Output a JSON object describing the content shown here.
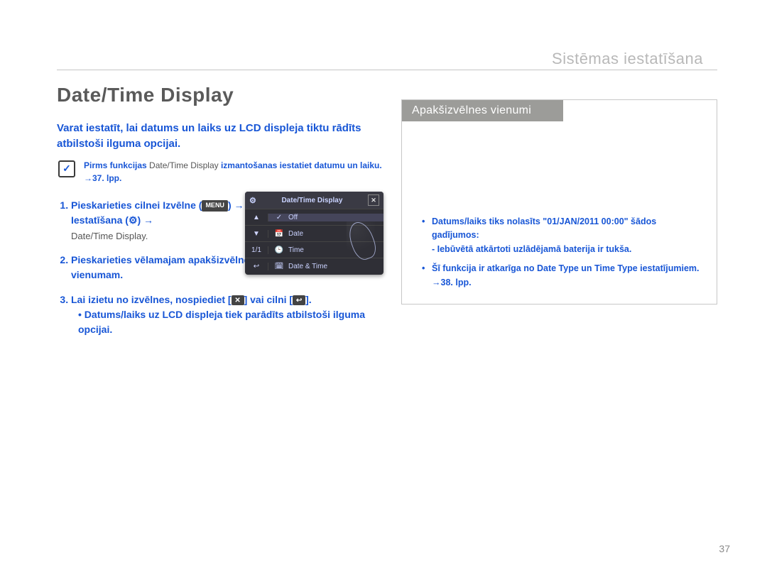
{
  "breadcrumb": "Sistēmas iestatīšana",
  "title": "Date/Time Display",
  "intro": "Varat iestatīt, lai datums un laiks uz LCD displeja tiktu rādīts atbilstoši ilguma opcijai.",
  "note": {
    "line1_pre": "Pirms funkcijas ",
    "line1_em": "Date/Time Display",
    "line1_post": " izmantošanas iestatiet datumu un laiku. →37. lpp."
  },
  "steps": {
    "s1_main": "Pieskarieties cilnei Izvēlne (",
    "s1_btn": "MENU",
    "s1_main2": ") → Iestatīšana (",
    "s1_icon": "⚙",
    "s1_main3": ") →",
    "s1_sub": "Date/Time Display.",
    "s2_main": "Pieskarieties vēlamajam apakšizvēlnes vienumam.",
    "s3_main": "Lai izietu no izvēlnes, nospiediet [",
    "s3_icon1": "✕",
    "s3_main2": "] vai cilni [",
    "s3_icon2": "↩",
    "s3_main3": "].",
    "s3_bullet": "Datums/laiks uz LCD displeja tiek parādīts atbilstoši ilguma opcijai."
  },
  "screen": {
    "title": "Date/Time Display",
    "row_off": "Off",
    "row_date": "Date",
    "row_time": "Time",
    "row_both": "Date & Time",
    "pager": "1/1"
  },
  "rightbox": {
    "header": "Apakšizvēlnes vienumi",
    "b1": "Datums/laiks tiks nolasīts \"01/JAN/2011 00:00\" šādos gadījumos:",
    "b1a": "- Iebūvētā atkārtoti uzlādējamā baterija ir tukša.",
    "b2": "Šī funkcija ir atkarīga no Date Type un Time Type iestatījumiem. →38. lpp."
  },
  "page_num": "37"
}
